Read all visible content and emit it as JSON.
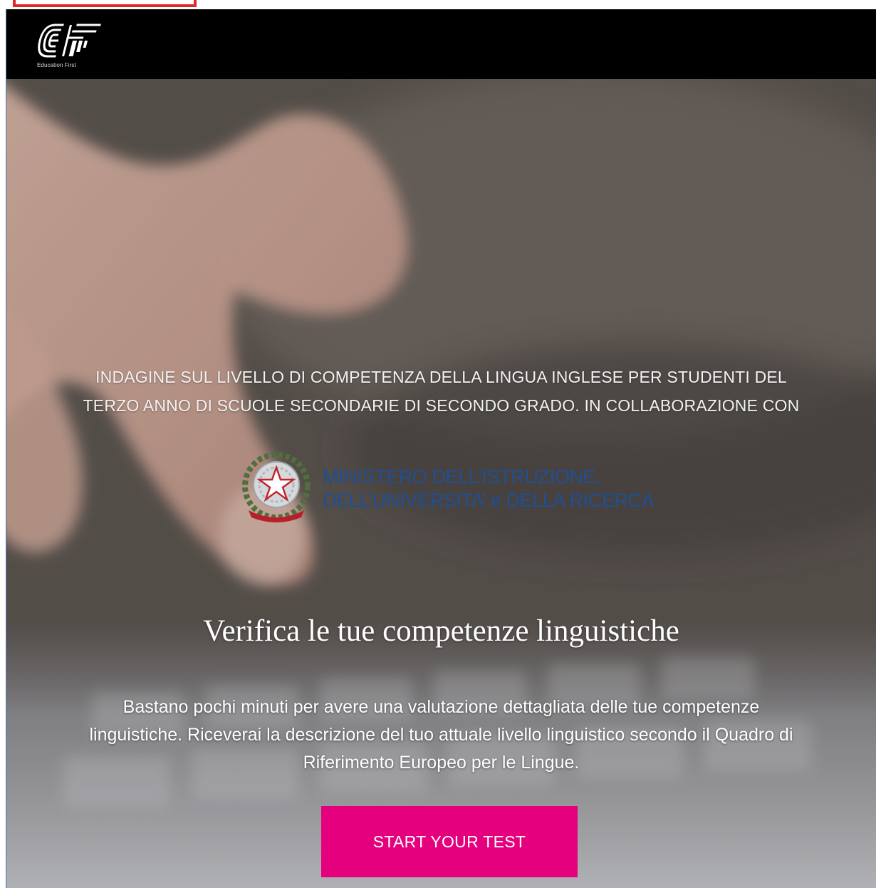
{
  "header": {
    "logo_alt": "EF",
    "logo_caption": "Education First"
  },
  "hero": {
    "intro_line1": "INDAGINE SUL LIVELLO DI COMPETENZA DELLA LINGUA INGLESE PER STUDENTI DEL",
    "intro_line2": "TERZO ANNO DI SCUOLE SECONDARIE DI SECONDO GRADO. IN COLLABORAZIONE CON",
    "ministry_line1": "MINISTERO DELL’ISTRUZIONE,",
    "ministry_line2": "DELL’UNIVERSITA’ e DELLA RICERCA",
    "headline": "Verifica le tue competenze linguistiche",
    "description_line1": "Bastano pochi minuti per avere una valutazione dettagliata delle tue competenze",
    "description_line2": "linguistiche. Riceverai la descrizione del tuo attuale livello linguistico secondo il Quadro di",
    "description_line3": "Riferimento Europeo per le Lingue.",
    "cta_label": "START YOUR TEST"
  },
  "colors": {
    "header_bg": "#000000",
    "ministry_text": "#1f4f96",
    "cta_bg": "#e5007e",
    "highlight_outline": "#e02a2a"
  },
  "icons": {
    "logo": "ef-logo-icon",
    "emblem": "italian-republic-emblem-icon"
  }
}
